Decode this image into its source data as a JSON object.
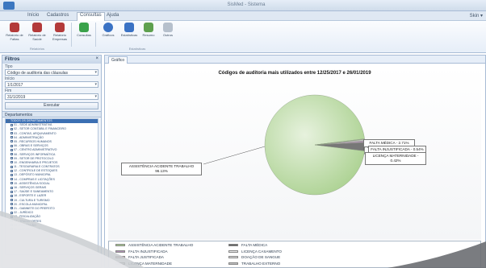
{
  "window": {
    "title": "SisMed - Sistema"
  },
  "menus": [
    "Início",
    "Cadastros",
    "Consultas",
    "Ajuda"
  ],
  "active_menu_index": 2,
  "skin_label": "Skin ▾",
  "ribbon": {
    "buttons": [
      {
        "label": "Relatório de Faltas",
        "icon": "report-red-icon",
        "color": "#b33a3a"
      },
      {
        "label": "Relatório de Saúde",
        "icon": "report-red-icon",
        "color": "#b33a3a"
      },
      {
        "label": "Relatório Empresas",
        "icon": "report-red-icon",
        "color": "#b33a3a"
      },
      {
        "label": "Consultas",
        "icon": "plus-icon",
        "color": "#3aa24a"
      },
      {
        "label": "Gráficos",
        "icon": "globe-icon",
        "color": "#3a72c4"
      },
      {
        "label": "Estatísticas",
        "icon": "people-icon",
        "color": "#3a72c4"
      },
      {
        "label": "Resumo",
        "icon": "tree-icon",
        "color": "#5ea04e"
      },
      {
        "label": "Outros",
        "icon": "doc-icon",
        "color": "#b6c0cc"
      }
    ],
    "groups": [
      "Relatórios",
      "Estatísticas"
    ]
  },
  "sidebar": {
    "title": "Filtros",
    "close": "×",
    "fields": [
      {
        "label": "Tipo",
        "value": "Código de auditoria das cláusulas"
      },
      {
        "label": "Início",
        "value": "1/1/2017"
      },
      {
        "label": "Fim",
        "value": "31/1/2019"
      }
    ],
    "execute_label": "Executar",
    "tree_title": "Departamentos",
    "tree_items": [
      "TODOS OS DEPARTAMENTOS",
      "01 - SEDE ADMINISTRATIVA",
      "02 - SETOR CONTÁBIL E FINANCEIRO",
      "03 - CONTAS, ARQUIVAMENTO",
      "04 - ADMINISTRAÇÃO",
      "05 - RECURSOS HUMANOS",
      "06 - OBRAS E SERVIÇOS",
      "07 - CENTRO ADMINISTRATIVO",
      "08 - SERVIÇOS INFORMÁTICA",
      "09 - SETOR DE PROTOCOLO",
      "10 - ENGENHARIA E PROJETOS",
      "11 - TESOURARIA E CONTRATOS",
      "12 - CONTROLE DE ESTOQUES",
      "13 - DEPÓSITO MUNICIPAL",
      "14 - COMPRAS E LICITAÇÕES",
      "15 - ASSISTÊNCIA SOCIAL",
      "16 - SERVIÇOS GERAIS",
      "17 - SAÚDE E SANEAMENTO",
      "18 - ESPORTE E LAZER",
      "19 - CULTURA E TURISMO",
      "20 - ESCOLA MUNICIPAL",
      "21 - GABINETE DO PREFEITO",
      "22 - JURÍDICO",
      "23 - FISCALIZAÇÃO",
      "24 - TRANSPORTES",
      "25 - HABITAÇÃO",
      "26 - AGRICULTURA"
    ]
  },
  "tab": {
    "label": "Gráfico"
  },
  "chart_data": {
    "type": "pie",
    "title": "Códigos de auditoria mais utilizados entre 12/25/2017 e 26/01/2019",
    "slices": [
      {
        "name": "ASSISTÊNCIA ACIDENTE TRABALHO",
        "percent": 96.13,
        "label": "ASSISTÊNCIA ACIDENTE TRABALHO\n96.13%",
        "color": "#a9d08e"
      },
      {
        "name": "FALTA MÉDICA",
        "percent": 2.71,
        "label": "FALTA MÉDICA - 2.71%",
        "color": "#777777"
      },
      {
        "name": "FALTA INJUSTIFICADA",
        "percent": 0.54,
        "label": "FALTA INJUSTIFICADA - 0.54%",
        "color": "#b090b4"
      },
      {
        "name": "LICENÇA MATERNIDADE",
        "percent": 0.42,
        "label": "LICENÇA MATERNIDADE - 0.42%",
        "color": "#c8c8c8"
      },
      {
        "name": "FALTA JUSTIFICADA",
        "percent": 0.1,
        "label": "FALTA JUSTIFICADA - 0.10%",
        "color": "#e4b3b3"
      },
      {
        "name": "LICENÇA CASAMENTO",
        "percent": 0.1,
        "label": "",
        "color": "#e8e8e8"
      }
    ],
    "legend": [
      {
        "name": "ASSISTÊNCIA ACIDENTE TRABALHO",
        "color": "#a9d08e"
      },
      {
        "name": "FALTA INJUSTIFICADA",
        "color": "#b090b4"
      },
      {
        "name": "FALTA JUSTIFICADA",
        "color": "#e4b3b3"
      },
      {
        "name": "LICENÇA MATERNIDADE",
        "color": "#c8c8c8"
      },
      {
        "name": "FALTA MÉDICA",
        "color": "#5a5a5a"
      },
      {
        "name": "LICENÇA CASAMENTO",
        "color": "#e8e8e8"
      },
      {
        "name": "DOAÇÃO DE SANGUE",
        "color": "#d9d9d9"
      },
      {
        "name": "TRABALHO EXTERNO",
        "color": "#bfbfbf"
      }
    ]
  }
}
